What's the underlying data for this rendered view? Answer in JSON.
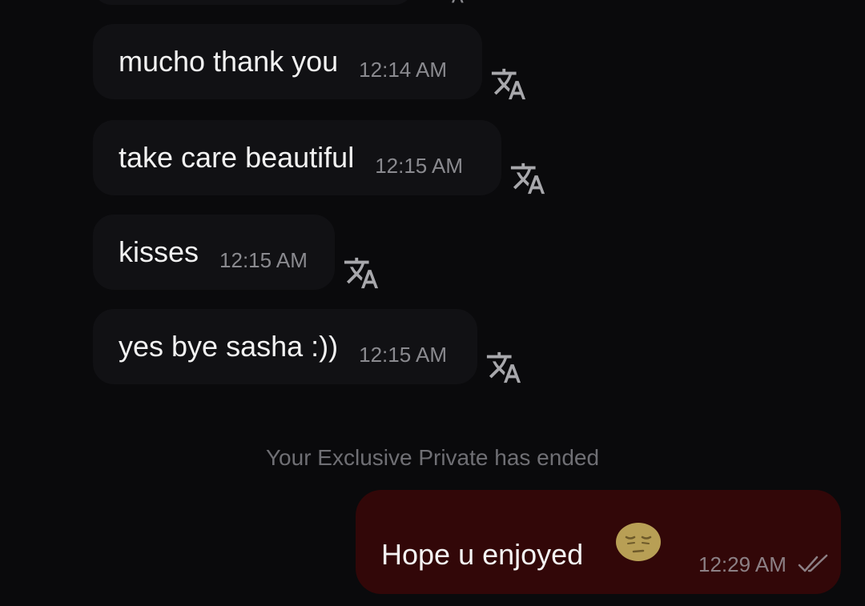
{
  "incoming_messages": [
    {
      "text": "mucho thank you",
      "time": "12:14 AM",
      "translate_icon": "translate-icon"
    },
    {
      "text": "take care beautiful",
      "time": "12:15 AM",
      "translate_icon": "translate-icon"
    },
    {
      "text": "kisses",
      "time": "12:15 AM",
      "translate_icon": "translate-icon"
    },
    {
      "text": "yes bye sasha :))",
      "time": "12:15 AM",
      "translate_icon": "translate-icon"
    }
  ],
  "system_message": "Your Exclusive Private has ended",
  "outgoing_message": {
    "text": "Hope u enjoyed",
    "emoji": "pensive-face-emoji",
    "time": "12:29 AM",
    "status_icon": "double-check-icon"
  },
  "colors": {
    "background": "#0a0a0c",
    "incoming_bubble": "#111114",
    "outgoing_bubble": "#320708",
    "timestamp": "#8a8a8f",
    "system_text": "#6f6f74",
    "emoji": "#b89f55"
  }
}
